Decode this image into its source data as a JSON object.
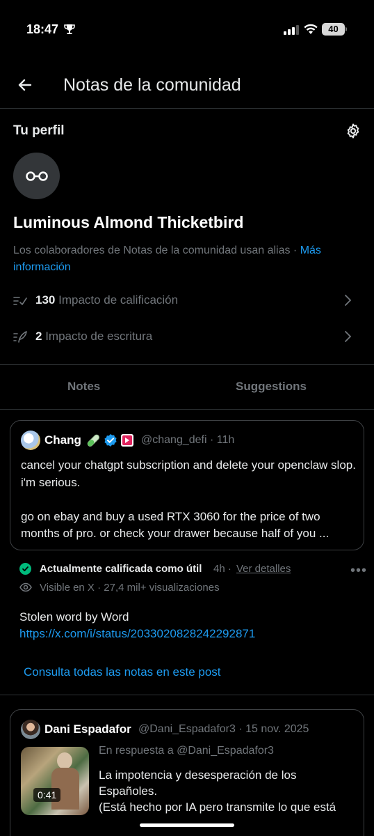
{
  "status_bar": {
    "time": "18:47",
    "battery": "40"
  },
  "header": {
    "title": "Notas de la comunidad"
  },
  "profile": {
    "section_label": "Tu perfil",
    "alias": "Luminous Almond Thicketbird",
    "description": "Los colaboradores de Notas de la comunidad usan alias · ",
    "more_link": "Más información",
    "stats": [
      {
        "value": "130",
        "label": "Impacto de calificación"
      },
      {
        "value": "2",
        "label": "Impacto de escritura"
      }
    ]
  },
  "tabs": [
    {
      "label": "Notes"
    },
    {
      "label": "Suggestions"
    }
  ],
  "post": {
    "name": "Chang",
    "handle": "@chang_defi · 11h",
    "text": "cancel your chatgpt subscription and delete your openclaw slop. i'm serious.\n\ngo on ebay and buy a used RTX 3060 for the price of two months of pro. or check your drawer because half of you ..."
  },
  "note": {
    "status": "Actualmente calificada como útil",
    "time": "4h ·",
    "details_link": "Ver detalles",
    "visibility": "Visible en X · 27,4 mil+ visualizaciones",
    "body": "Stolen word by Word",
    "url": "https://x.com/i/status/2033020828242292871",
    "all_notes_link": "Consulta todas las notas en este post"
  },
  "post2": {
    "name": "Dani Espadafor",
    "handle": "@Dani_Espadafor3 · 15 nov. 2025",
    "reply_to": "En respuesta a @Dani_Espadafor3",
    "duration": "0:41",
    "text": "La impotencia y desesperación de los Españoles.\n(Está hecho por IA pero transmite lo que está"
  },
  "colors": {
    "accent": "#1d9bf0",
    "success": "#00ba7c",
    "muted": "#71767b",
    "divider": "#2f3336"
  },
  "icons": [
    "trophy-icon",
    "signal-icon",
    "wifi-icon",
    "back-arrow-icon",
    "gear-icon",
    "glasses-icon",
    "rating-icon",
    "writing-icon",
    "chevron-right-icon",
    "verified-icon",
    "eye-icon",
    "more-icon",
    "check-icon"
  ]
}
